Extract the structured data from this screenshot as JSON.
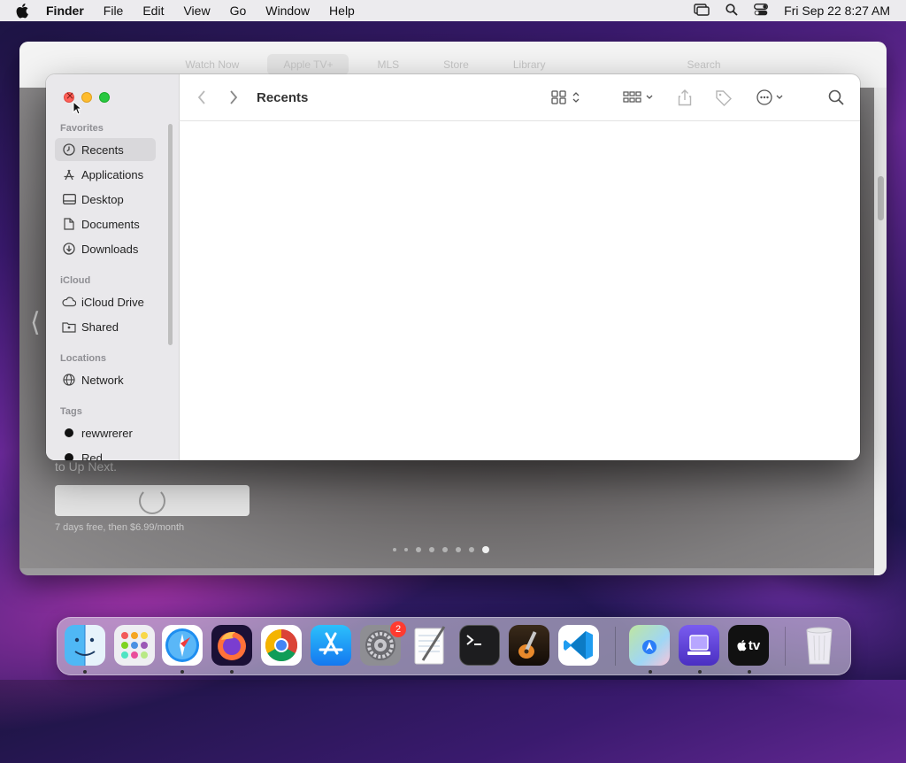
{
  "menubar": {
    "app_name": "Finder",
    "items": [
      "File",
      "Edit",
      "View",
      "Go",
      "Window",
      "Help"
    ],
    "clock": "Fri Sep 22  8:27 AM"
  },
  "background_window": {
    "toolbar_tabs": [
      "Watch Now",
      "Apple TV+",
      "MLS",
      "Store",
      "Library",
      "Search"
    ],
    "up_next_text": "to Up Next.",
    "price_text": "7 days free, then $6.99/month"
  },
  "finder": {
    "title": "Recents",
    "sections": {
      "favorites": "Favorites",
      "icloud": "iCloud",
      "locations": "Locations",
      "tags": "Tags"
    },
    "favorites": [
      "Recents",
      "Applications",
      "Desktop",
      "Documents",
      "Downloads"
    ],
    "icloud": [
      "iCloud Drive",
      "Shared"
    ],
    "locations": [
      "Network"
    ],
    "tags": [
      "rewwrerer",
      "Red"
    ]
  },
  "dock": {
    "apps": [
      "Finder",
      "Launchpad",
      "Safari",
      "Firefox",
      "Chrome",
      "App Store",
      "System Settings",
      "TextEdit",
      "Terminal",
      "GarageBand",
      "Visual Studio Code",
      "Maps",
      "Simulator",
      "TV",
      "Trash"
    ],
    "settings_badge": "2",
    "tv_label": "tv"
  },
  "colors": {
    "close": "#ff5f57",
    "minimize": "#febc2e",
    "maximize": "#28c840",
    "badge": "#ff3b30"
  }
}
